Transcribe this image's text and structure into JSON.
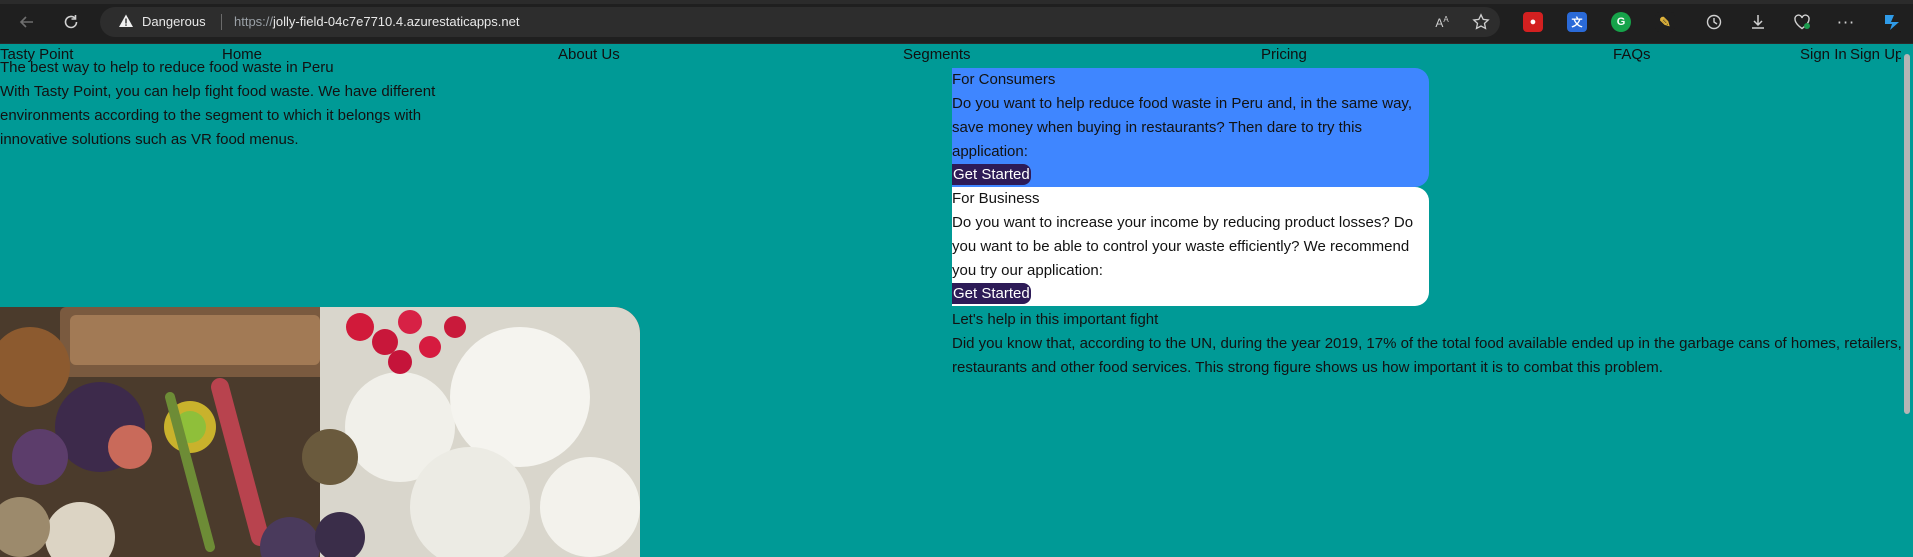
{
  "browser": {
    "security_label": "Dangerous",
    "url_protocol": "https://",
    "url_host": "jolly-field-04c7e7710.4.azurestaticapps.net"
  },
  "nav": {
    "brand": "Tasty Point",
    "home": "Home",
    "about": "About Us",
    "segments": "Segments",
    "pricing": "Pricing",
    "faqs": "FAQs",
    "sign_in": "Sign In",
    "sign_up": "Sign Up"
  },
  "hero": {
    "tagline": "The best way to help to reduce food waste in Peru",
    "description": "With Tasty Point, you can help fight food waste. We have different environments according to the segment to which it belongs with innovative solutions such as VR food menus."
  },
  "consumers": {
    "title": "For Consumers",
    "text": "Do you want to help reduce food waste in Peru and, in the same way, save money when buying in restaurants? Then dare to try this application:",
    "button": "Get Started"
  },
  "business": {
    "title": "For Business",
    "text": "Do you want to increase your income by reducing product losses? Do you want to be able to control your waste efficiently? We recommend you try our application:",
    "button": "Get Started"
  },
  "fight": {
    "title": "Let's help in this important fight",
    "text": "Did you know that, according to the UN, during the year 2019, 17% of the total food available ended up in the garbage cans of homes, retailers, restaurants and other food services. This strong figure shows us how important it is to combat this problem."
  },
  "colors": {
    "page_bg": "#009a96",
    "consumer_card": "#3f86ff",
    "business_card": "#ffffff",
    "button_bg": "#2d1b57"
  },
  "icons": [
    "back-icon",
    "reload-icon",
    "warning-icon",
    "read-aloud-icon",
    "favorite-star-icon",
    "extension-icon",
    "history-icon",
    "download-icon",
    "health-icon",
    "more-icon",
    "copilot-icon"
  ]
}
